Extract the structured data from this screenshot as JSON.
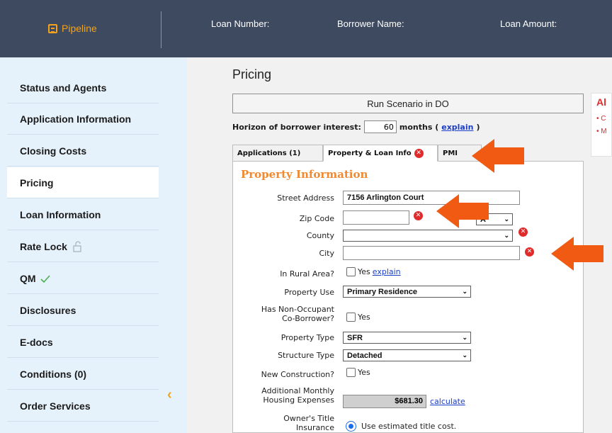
{
  "header": {
    "pipeline_label": "Pipeline",
    "loan_number_label": "Loan Number:",
    "borrower_name_label": "Borrower Name:",
    "loan_amount_label": "Loan Amount:"
  },
  "sidebar": {
    "items": [
      {
        "label": "Status and Agents"
      },
      {
        "label": "Application Information"
      },
      {
        "label": "Closing Costs"
      },
      {
        "label": "Pricing"
      },
      {
        "label": "Loan Information"
      },
      {
        "label": "Rate Lock"
      },
      {
        "label": "QM"
      },
      {
        "label": "Disclosures"
      },
      {
        "label": "E-docs"
      },
      {
        "label": "Conditions (0)"
      },
      {
        "label": "Order Services"
      }
    ],
    "active": "Pricing",
    "collapse_icon": "chevron-left-icon"
  },
  "main": {
    "title": "Pricing",
    "run_button": "Run Scenario in DO",
    "horizon": {
      "label": "Horizon of borrower interest:",
      "value": "60",
      "suffix": "months (",
      "link": "explain",
      "close": ")"
    },
    "tabs": [
      {
        "label": "Applications (1)",
        "error": false
      },
      {
        "label": "Property & Loan Info",
        "error": true
      },
      {
        "label": "PMI",
        "error": false
      }
    ],
    "section_title": "Property Information",
    "fields": {
      "street_address": {
        "label": "Street Address",
        "value": "7156 Arlington Court"
      },
      "zip_code": {
        "label": "Zip Code",
        "value": "",
        "state_value": "A"
      },
      "county": {
        "label": "County",
        "value": ""
      },
      "city": {
        "label": "City",
        "value": ""
      },
      "rural": {
        "label": "In Rural Area?",
        "option": "Yes",
        "link": "explain"
      },
      "property_use": {
        "label": "Property Use",
        "value": "Primary Residence"
      },
      "non_occupant": {
        "label_line1": "Has Non-Occupant",
        "label_line2": "Co-Borrower?",
        "option": "Yes"
      },
      "property_type": {
        "label": "Property Type",
        "value": "SFR"
      },
      "structure_type": {
        "label": "Structure Type",
        "value": "Detached"
      },
      "new_construction": {
        "label": "New Construction?",
        "option": "Yes"
      },
      "housing_expenses": {
        "label_line1": "Additional Monthly",
        "label_line2": "Housing Expenses",
        "value": "$681.30",
        "link": "calculate"
      },
      "title_insurance": {
        "label_line1": "Owner's Title",
        "label_line2": "Insurance",
        "option": "Use estimated title cost."
      }
    }
  },
  "alerts": {
    "title": "Al",
    "items": [
      "C",
      "M"
    ]
  },
  "colors": {
    "topbar": "#3d4a5f",
    "accent_orange": "#f3a21c",
    "sidebar_bg": "#e6f2fb",
    "error_red": "#df2b2b",
    "arrow_orange": "#f05a12",
    "link_blue": "#1a3ec8"
  }
}
